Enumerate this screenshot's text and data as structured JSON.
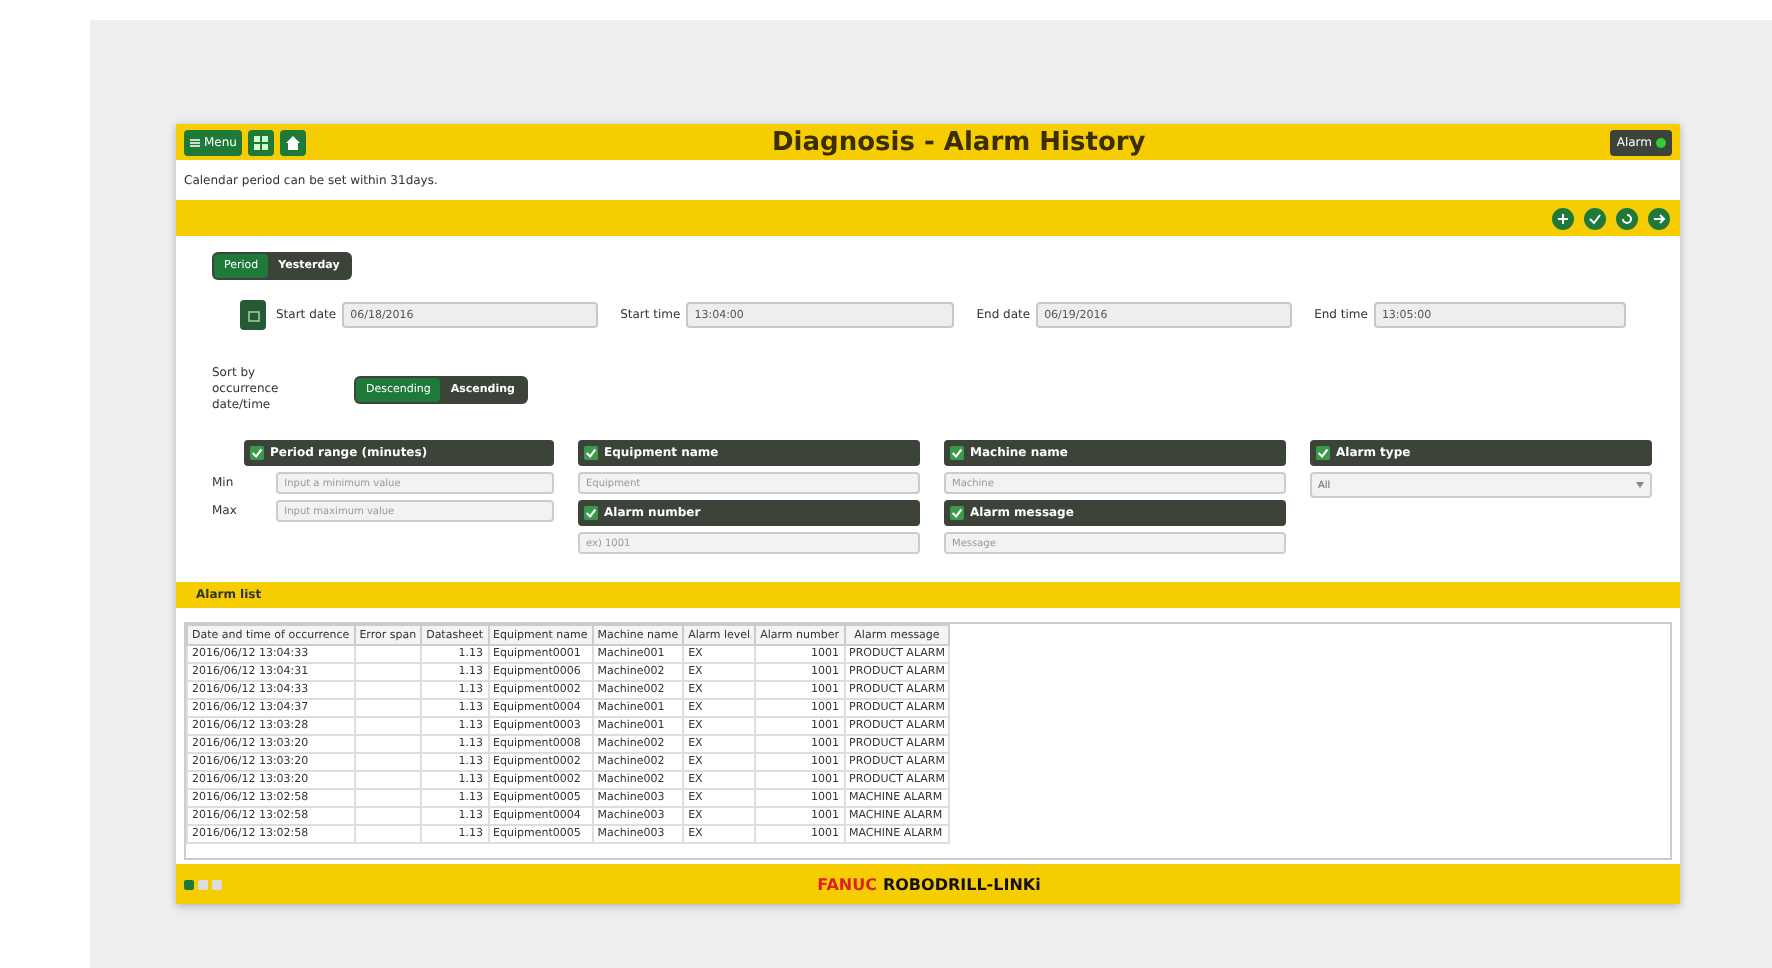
{
  "header": {
    "menu_button": "Menu",
    "title": "Diagnosis - Alarm History",
    "right_button": "Alarm"
  },
  "notice": "Calendar period can be set within 31days.",
  "period_toggle": [
    {
      "label": "Period",
      "selected": true
    },
    {
      "label": "Yesterday",
      "selected": false
    }
  ],
  "date_fields": [
    {
      "label": "Start date",
      "value": "06/18/2016"
    },
    {
      "label": "Start time",
      "value": "13:04:00"
    },
    {
      "label": "End date",
      "value": "06/19/2016"
    },
    {
      "label": "End time",
      "value": "13:05:00"
    }
  ],
  "sort": {
    "label": "Sort by occurrence date/time",
    "options": [
      {
        "label": "Descending",
        "selected": true
      },
      {
        "label": "Ascending",
        "selected": false
      }
    ]
  },
  "filter_columns": [
    [
      {
        "kind": "range",
        "title": "Period range (minutes)",
        "checked": true,
        "rows": [
          {
            "label": "Min",
            "placeholder": "Input a minimum value"
          },
          {
            "label": "Max",
            "placeholder": "Input maximum value"
          }
        ]
      }
    ],
    [
      {
        "kind": "text",
        "title": "Equipment name",
        "checked": true,
        "placeholder": "Equipment"
      },
      {
        "kind": "text",
        "title": "Alarm number",
        "checked": true,
        "placeholder": "ex) 1001"
      }
    ],
    [
      {
        "kind": "text",
        "title": "Machine name",
        "checked": true,
        "placeholder": "Machine"
      },
      {
        "kind": "text",
        "title": "Alarm message",
        "checked": true,
        "placeholder": "Message"
      }
    ],
    [
      {
        "kind": "select",
        "title": "Alarm type",
        "checked": true,
        "value": "All"
      }
    ]
  ],
  "alarm_list": {
    "title": "Alarm list",
    "columns": [
      "Date and time of occurrence",
      "Error span",
      "Datasheet",
      "Equipment name",
      "Machine name",
      "Alarm level",
      "Alarm number",
      "Alarm message"
    ],
    "rows": [
      [
        "2016/06/12 13:04:33",
        "",
        "1.13",
        "Equipment0001",
        "Machine001",
        "EX",
        "1001",
        "PRODUCT ALARM"
      ],
      [
        "2016/06/12 13:04:31",
        "",
        "1.13",
        "Equipment0006",
        "Machine002",
        "EX",
        "1001",
        "PRODUCT ALARM"
      ],
      [
        "2016/06/12 13:04:33",
        "",
        "1.13",
        "Equipment0002",
        "Machine002",
        "EX",
        "1001",
        "PRODUCT ALARM"
      ],
      [
        "2016/06/12 13:04:37",
        "",
        "1.13",
        "Equipment0004",
        "Machine001",
        "EX",
        "1001",
        "PRODUCT ALARM"
      ],
      [
        "2016/06/12 13:03:28",
        "",
        "1.13",
        "Equipment0003",
        "Machine001",
        "EX",
        "1001",
        "PRODUCT ALARM"
      ],
      [
        "2016/06/12 13:03:20",
        "",
        "1.13",
        "Equipment0008",
        "Machine002",
        "EX",
        "1001",
        "PRODUCT ALARM"
      ],
      [
        "2016/06/12 13:03:20",
        "",
        "1.13",
        "Equipment0002",
        "Machine002",
        "EX",
        "1001",
        "PRODUCT ALARM"
      ],
      [
        "2016/06/12 13:03:20",
        "",
        "1.13",
        "Equipment0002",
        "Machine002",
        "EX",
        "1001",
        "PRODUCT ALARM"
      ],
      [
        "2016/06/12 13:02:58",
        "",
        "1.13",
        "Equipment0005",
        "Machine003",
        "EX",
        "1001",
        "MACHINE ALARM"
      ],
      [
        "2016/06/12 13:02:58",
        "",
        "1.13",
        "Equipment0004",
        "Machine003",
        "EX",
        "1001",
        "MACHINE ALARM"
      ],
      [
        "2016/06/12 13:02:58",
        "",
        "1.13",
        "Equipment0005",
        "Machine003",
        "EX",
        "1001",
        "MACHINE ALARM"
      ]
    ]
  },
  "footer": {
    "page_dots": [
      {
        "selected": true
      },
      {
        "selected": false
      },
      {
        "selected": false
      }
    ],
    "brand_maker": "FANUC",
    "brand_product": "ROBODRILL-LINKi"
  }
}
